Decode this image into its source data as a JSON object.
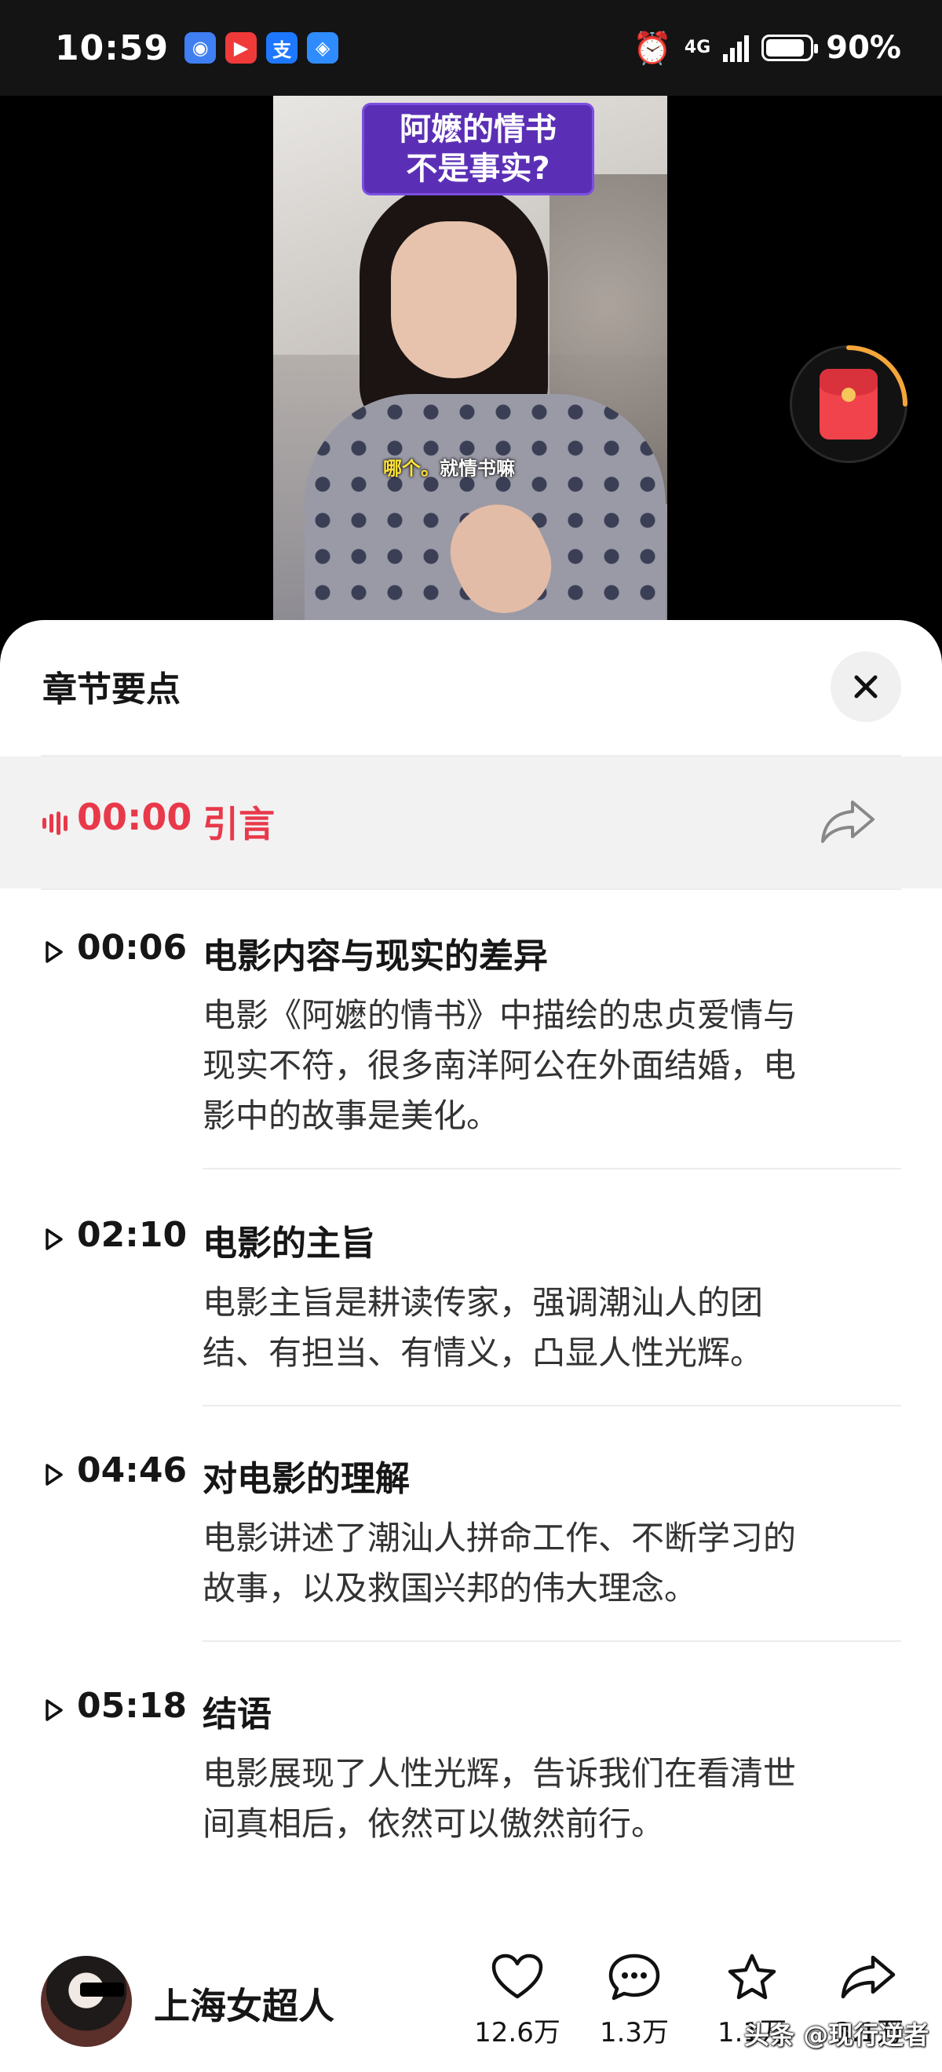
{
  "status_bar": {
    "time": "10:59",
    "network": "4G",
    "battery": "90%",
    "battery_level": 0.9,
    "app_icons": [
      "browser-icon",
      "video-app-icon",
      "alipay-icon",
      "assistant-icon"
    ]
  },
  "video": {
    "caption_line1": "阿嬷的情书",
    "caption_line2": "不是事实?",
    "subtitle_highlight": "哪个。",
    "subtitle_rest": "就情书嘛"
  },
  "sheet": {
    "title": "章节要点",
    "current": {
      "time": "00:00",
      "title": "引言"
    },
    "chapters": [
      {
        "time": "00:06",
        "title": "电影内容与现实的差异",
        "desc": [
          "电影《阿嬷的情书》中描绘的忠贞爱情与",
          "现实不符，很多南洋阿公在外面结婚，电",
          "影中的故事是美化。"
        ]
      },
      {
        "time": "02:10",
        "title": "电影的主旨",
        "desc": [
          "电影主旨是耕读传家，强调潮汕人的团",
          "结、有担当、有情义，凸显人性光辉。"
        ]
      },
      {
        "time": "04:46",
        "title": "对电影的理解",
        "desc": [
          "电影讲述了潮汕人拼命工作、不断学习的",
          "故事，以及救国兴邦的伟大理念。"
        ]
      },
      {
        "time": "05:18",
        "title": "结语",
        "desc": [
          "电影展现了人性光辉，告诉我们在看清世",
          "间真相后，依然可以傲然前行。"
        ]
      }
    ]
  },
  "bottom_bar": {
    "author": "上海女超人",
    "like_count": "12.6万",
    "comment_count": "1.3万",
    "favorite_count": "1.1万",
    "share_count": "3.1万",
    "watermark": "头条 @现行逆者"
  },
  "colors": {
    "accent": "#e8394a",
    "caption_bg": "#5b2fb5",
    "redpacket": "#f0434b"
  }
}
